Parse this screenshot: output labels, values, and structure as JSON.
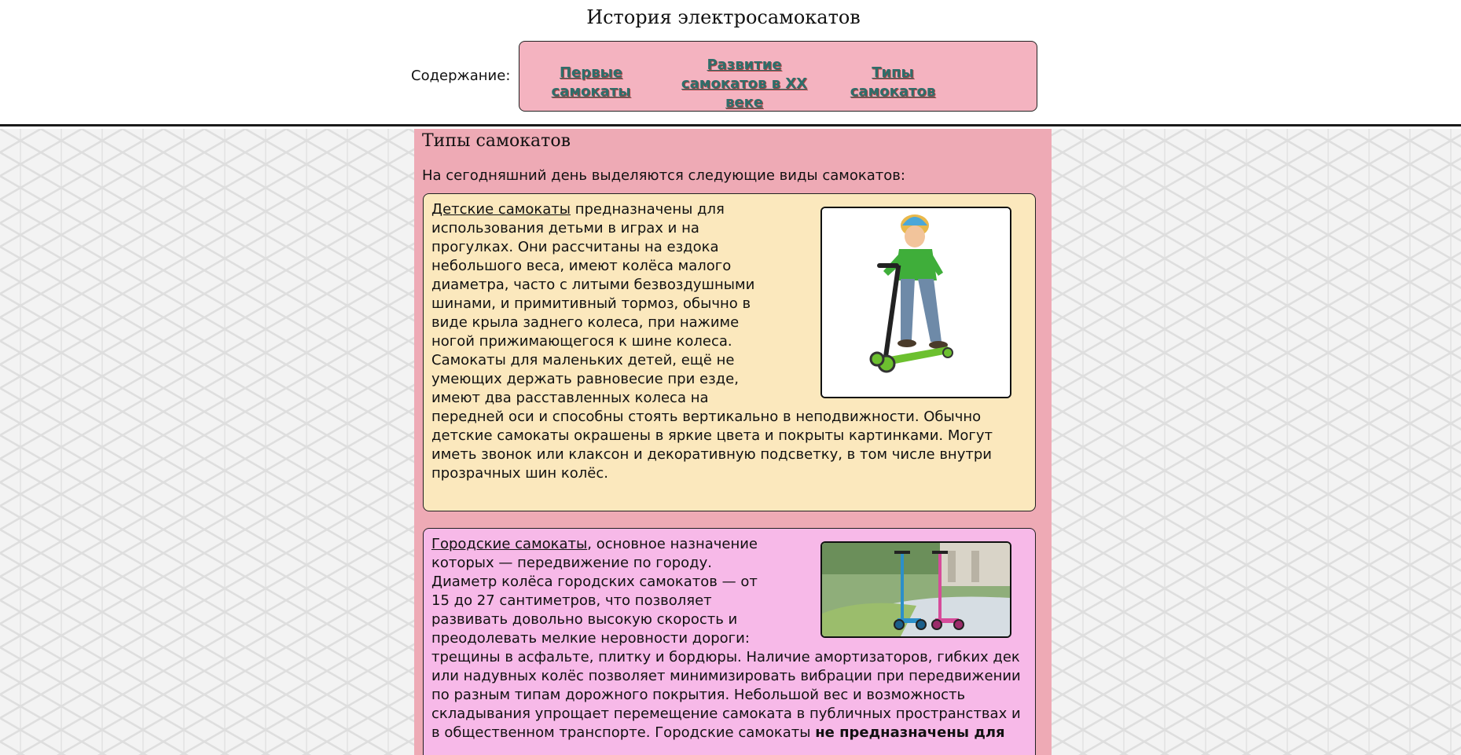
{
  "header": {
    "title": "История электросамокатов",
    "toc_label": "Содержание:",
    "toc_links": [
      "Первые самокаты",
      "Развитие самокатов в XX веке",
      "Типы самокатов"
    ]
  },
  "section": {
    "title": "Типы самокатов",
    "intro": "На сегодняшний день выделяются следующие виды самокатов:",
    "cards": [
      {
        "term": "Детские самокаты",
        "text": " предназначены для использования детьми в играх и на прогулках. Они рассчитаны на ездока небольшого веса, имеют колёса малого диаметра, часто с литыми безвоздушными шинами, и примитивный тормоз, обычно в виде крыла заднего колеса, при нажиме ногой прижимающегося к шине колеса. Самокаты для маленьких детей, ещё не умеющих держать равновесие при езде, имеют два расставленных колеса на передней оси и способны стоять вертикально в неподвижности. Обычно детские самокаты окрашены в яркие цвета и покрыты картинками. Могут иметь звонок или клаксон и декоративную подсветку, в том числе внутри прозрачных шин колёс.",
        "image": "child-on-scooter-photo"
      },
      {
        "term": "Городские самокаты",
        "text": ", основное назначение которых — передвижение по городу. Диаметр колёса городских самокатов — от 15 до 27 сантиметров, что позволяет развивать довольно высокую скорость и преодолевать мелкие неровности дороги: трещины в асфальте, плитку и бордюры. Наличие амортизаторов, гибких дек или надувных колёс позволяет минимизировать вибрации при передвижении по разным типам дорожного покрытия. Небольшой вес и возможность складывания упрощает перемещение самоката в публичных пространствах и в общественном транспорте. Городские самокаты ",
        "bold_text": "не предназначены для",
        "image": "city-scooters-photo"
      }
    ]
  },
  "colors": {
    "toc_bg": "#f4b3c0",
    "toc_link": "#2e6e6a",
    "main_bg": "#eeaab5",
    "card1_bg": "#fbe8bd",
    "card2_bg": "#f7b9e8"
  }
}
